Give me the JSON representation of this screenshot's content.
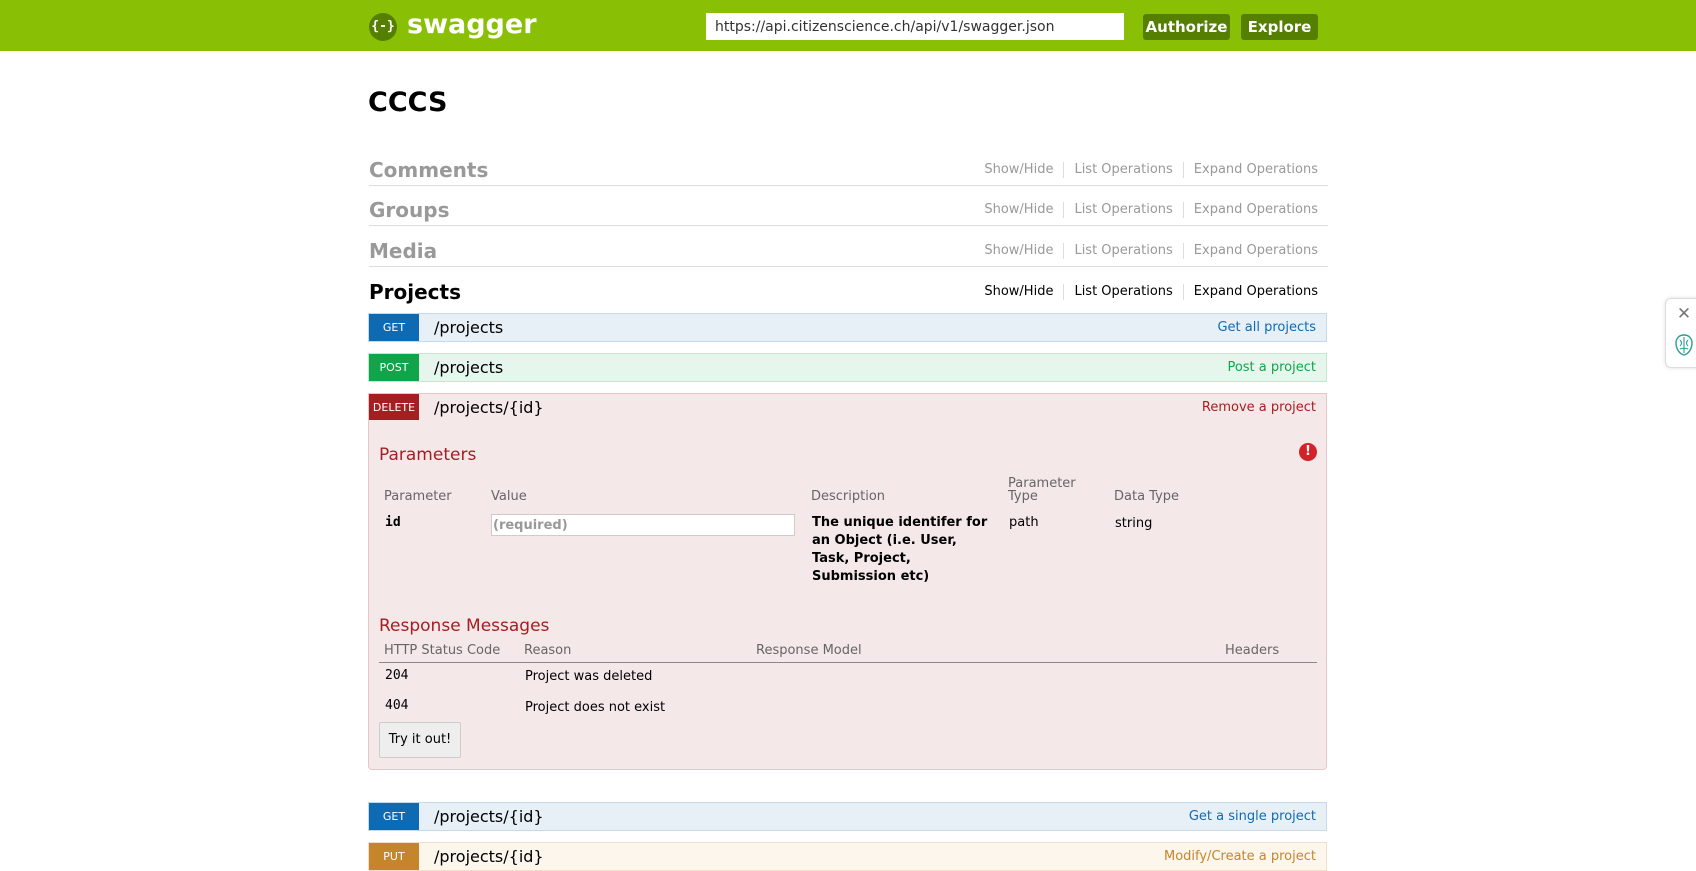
{
  "header": {
    "logo_mark": "{-}",
    "logo_text": "swagger",
    "api_url": "https://api.citizenscience.ch/api/v1/swagger.json",
    "authorize_label": "Authorize",
    "explore_label": "Explore"
  },
  "api_title": "CCCS",
  "resource_links": {
    "show_hide": "Show/Hide",
    "list_operations": "List Operations",
    "expand_operations": "Expand Operations"
  },
  "resources": [
    {
      "name": "Comments"
    },
    {
      "name": "Groups"
    },
    {
      "name": "Media"
    },
    {
      "name": "Projects"
    }
  ],
  "operations": [
    {
      "verb": "GET",
      "path": "/projects",
      "summary": "Get all projects"
    },
    {
      "verb": "POST",
      "path": "/projects",
      "summary": "Post a project"
    },
    {
      "verb": "DELETE",
      "path": "/projects/{id}",
      "summary": "Remove a project"
    },
    {
      "verb": "GET",
      "path": "/projects/{id}",
      "summary": "Get a single project"
    },
    {
      "verb": "PUT",
      "path": "/projects/{id}",
      "summary": "Modify/Create a project"
    }
  ],
  "delete_detail": {
    "parameters_title": "Parameters",
    "param_headers": {
      "parameter": "Parameter",
      "value": "Value",
      "description": "Description",
      "param_type_1": "Parameter",
      "param_type_2": "Type",
      "data_type": "Data Type"
    },
    "param": {
      "name": "id",
      "placeholder": "(required)",
      "description_lines": [
        "The unique identifer for",
        "an Object (i.e. User,",
        "Task, Project,",
        "Submission etc)"
      ],
      "param_type": "path",
      "data_type": "string"
    },
    "response_title": "Response Messages",
    "response_headers": {
      "code": "HTTP Status Code",
      "reason": "Reason",
      "model": "Response Model",
      "headers": "Headers"
    },
    "responses": [
      {
        "code": "204",
        "reason": "Project was deleted"
      },
      {
        "code": "404",
        "reason": "Project does not exist"
      }
    ],
    "try_label": "Try it out!"
  },
  "colors": {
    "header_green": "#89bf04",
    "get_blue": "#0f6ab4",
    "post_green": "#10a54a",
    "delete_red": "#a41e22",
    "put_orange": "#c5862b"
  },
  "icons": {
    "logo": "swagger-logo-icon",
    "warning": "warning-icon",
    "close": "close-icon",
    "brain": "brain-icon"
  }
}
